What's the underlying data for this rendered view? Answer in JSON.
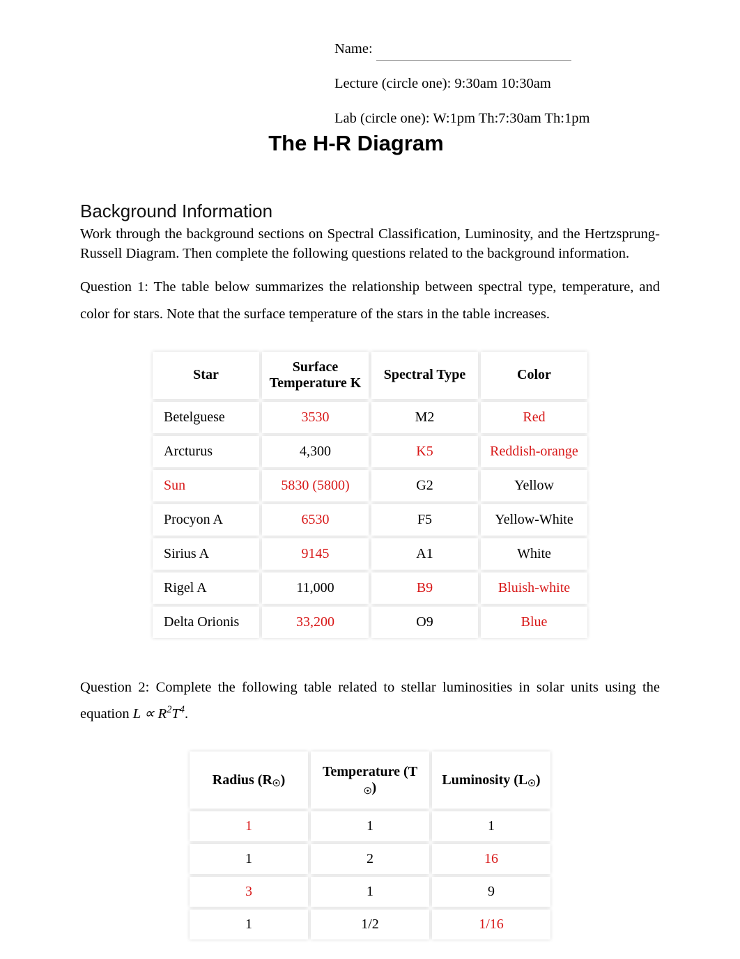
{
  "header": {
    "name_label": "Name:",
    "lecture_label": "Lecture (circle one): 9:30am   10:30am",
    "lab_label": "Lab (circle one): W:1pm Th:7:30am Th:1pm"
  },
  "title": "The H-R Diagram",
  "section_heading": "Background Information",
  "intro_para": "Work through the background sections on Spectral Classification, Luminosity, and the Hertzsprung-Russell Diagram. Then complete the following questions related to the background information.",
  "q1_text": "Question 1: The table below summarizes the relationship between spectral type, temperature, and color for stars.   Note that the surface temperature of the stars in the table increases.",
  "table1": {
    "headers": [
      "Star",
      "Surface Temperature K",
      "Spectral Type",
      "Color"
    ],
    "rows": [
      {
        "star": "Betelguese",
        "star_red": false,
        "temp": "3530",
        "temp_red": true,
        "spec": "M2",
        "spec_red": false,
        "color": "Red",
        "color_red": true
      },
      {
        "star": "Arcturus",
        "star_red": false,
        "temp": "4,300",
        "temp_red": false,
        "spec": "K5",
        "spec_red": true,
        "color": "Reddish-orange",
        "color_red": true
      },
      {
        "star": "Sun",
        "star_red": true,
        "temp": "5830 (5800)",
        "temp_red": true,
        "spec": "G2",
        "spec_red": false,
        "color": "Yellow",
        "color_red": false
      },
      {
        "star": "Procyon A",
        "star_red": false,
        "temp": "6530",
        "temp_red": true,
        "spec": "F5",
        "spec_red": false,
        "color": "Yellow-White",
        "color_red": false
      },
      {
        "star": "Sirius A",
        "star_red": false,
        "temp": "9145",
        "temp_red": true,
        "spec": "A1",
        "spec_red": false,
        "color": "White",
        "color_red": false
      },
      {
        "star": "Rigel A",
        "star_red": false,
        "temp": "11,000",
        "temp_red": false,
        "spec": "B9",
        "spec_red": true,
        "color": "Bluish-white",
        "color_red": true
      },
      {
        "star": "Delta Orionis",
        "star_red": false,
        "temp": "33,200",
        "temp_red": true,
        "spec": "O9",
        "spec_red": false,
        "color": "Blue",
        "color_red": true
      }
    ]
  },
  "q2_text_prefix": "Question 2: Complete the following table related to stellar luminosities in solar units using the equation ",
  "q2_eqn_html": "L ∝ R²T⁴",
  "q2_text_suffix": ".",
  "table2": {
    "headers": [
      "Radius (R☉)",
      "Temperature (T ☉)",
      "Luminosity (L☉)"
    ],
    "rows": [
      {
        "r": "1",
        "r_red": true,
        "t": "1",
        "t_red": false,
        "l": "1",
        "l_red": false
      },
      {
        "r": "1",
        "r_red": false,
        "t": "2",
        "t_red": false,
        "l": "16",
        "l_red": true
      },
      {
        "r": "3",
        "r_red": true,
        "t": "1",
        "t_red": false,
        "l": "9",
        "l_red": false
      },
      {
        "r": "1",
        "r_red": false,
        "t": "1/2",
        "t_red": false,
        "l": "1/16",
        "l_red": true
      }
    ]
  }
}
